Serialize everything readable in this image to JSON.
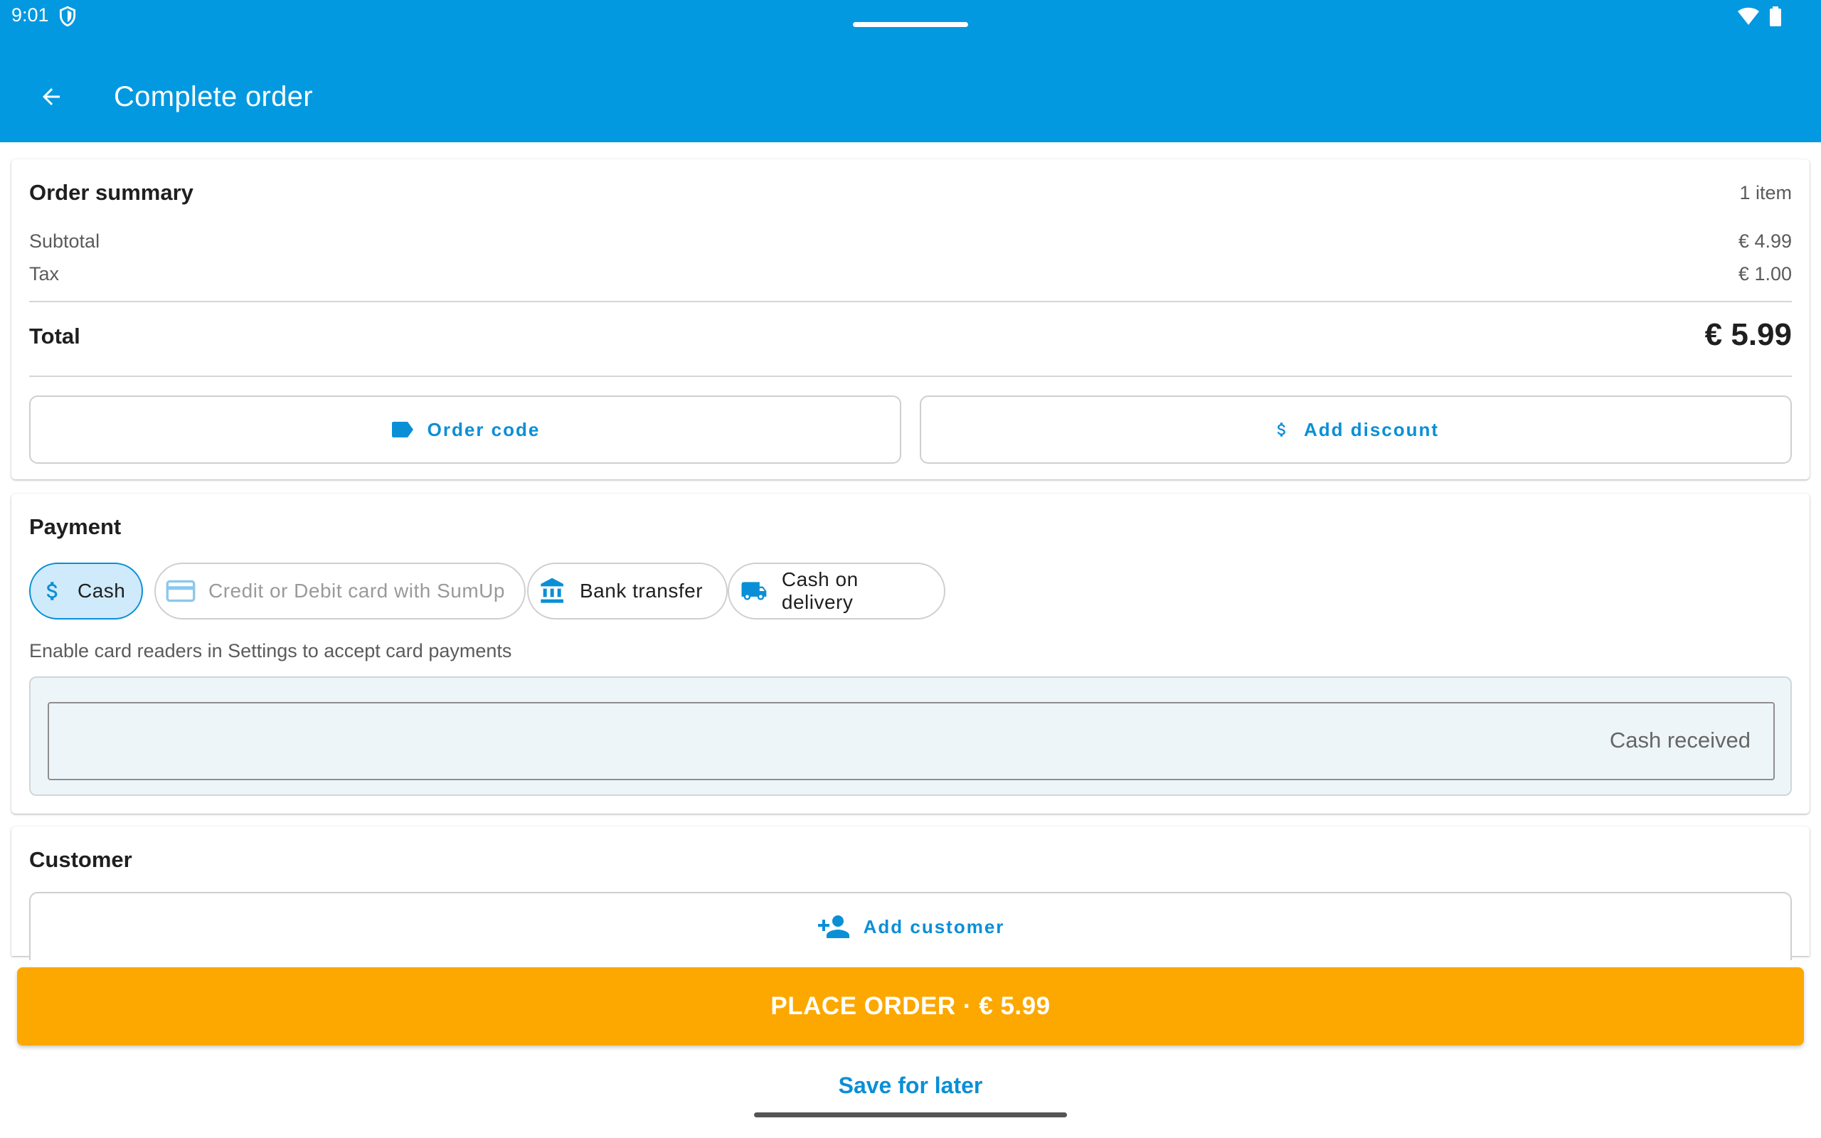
{
  "status_bar": {
    "time": "9:01"
  },
  "app_bar": {
    "title": "Complete order"
  },
  "order_summary": {
    "heading": "Order summary",
    "item_count": "1 item",
    "subtotal_label": "Subtotal",
    "subtotal_value": "€ 4.99",
    "tax_label": "Tax",
    "tax_value": "€ 1.00",
    "total_label": "Total",
    "total_value": "€ 5.99",
    "order_code_label": "Order code",
    "add_discount_label": "Add discount"
  },
  "payment": {
    "heading": "Payment",
    "methods": [
      {
        "label": "Cash",
        "icon": "dollar-icon",
        "selected": true
      },
      {
        "label": "Credit or Debit card with SumUp",
        "icon": "credit-card-icon",
        "disabled": true
      },
      {
        "label": "Bank transfer",
        "icon": "bank-icon"
      },
      {
        "label": "Cash on delivery",
        "icon": "truck-icon"
      }
    ],
    "hint": "Enable card readers in Settings to accept card payments",
    "cash_received_placeholder": "Cash received"
  },
  "customer": {
    "heading": "Customer",
    "add_customer_label": "Add customer"
  },
  "footer": {
    "place_order_label": "PLACE ORDER · € 5.99",
    "save_for_later_label": "Save for later"
  },
  "colors": {
    "primary": "#0399e0",
    "accent": "#fca800",
    "link": "#0a8fd6"
  }
}
